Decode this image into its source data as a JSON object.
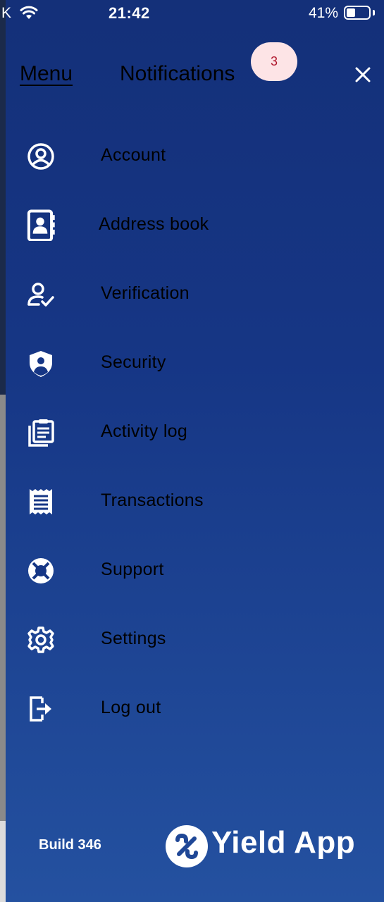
{
  "status_bar": {
    "carrier": "K",
    "time": "21:42",
    "battery_percent": "41%",
    "battery_level": 0.41
  },
  "header": {
    "menu_tab": "Menu",
    "notifications_tab": "Notifications",
    "notifications_count": "3"
  },
  "menu": {
    "items": [
      {
        "label": "Account",
        "icon": "account-circle-icon"
      },
      {
        "label": "Address book",
        "icon": "address-book-icon"
      },
      {
        "label": "Verification",
        "icon": "user-check-icon"
      },
      {
        "label": "Security",
        "icon": "shield-icon"
      },
      {
        "label": "Activity log",
        "icon": "clipboard-list-icon"
      },
      {
        "label": "Transactions",
        "icon": "receipt-icon"
      },
      {
        "label": "Support",
        "icon": "lifebuoy-icon"
      },
      {
        "label": "Settings",
        "icon": "gear-icon"
      },
      {
        "label": "Log out",
        "icon": "logout-icon"
      }
    ]
  },
  "footer": {
    "build": "Build 346",
    "brand_name": "Yield App"
  },
  "colors": {
    "drawer_top": "#143079",
    "drawer_bottom": "#2451a0",
    "badge_bg": "#fde4e6",
    "badge_text": "#b0182e"
  }
}
